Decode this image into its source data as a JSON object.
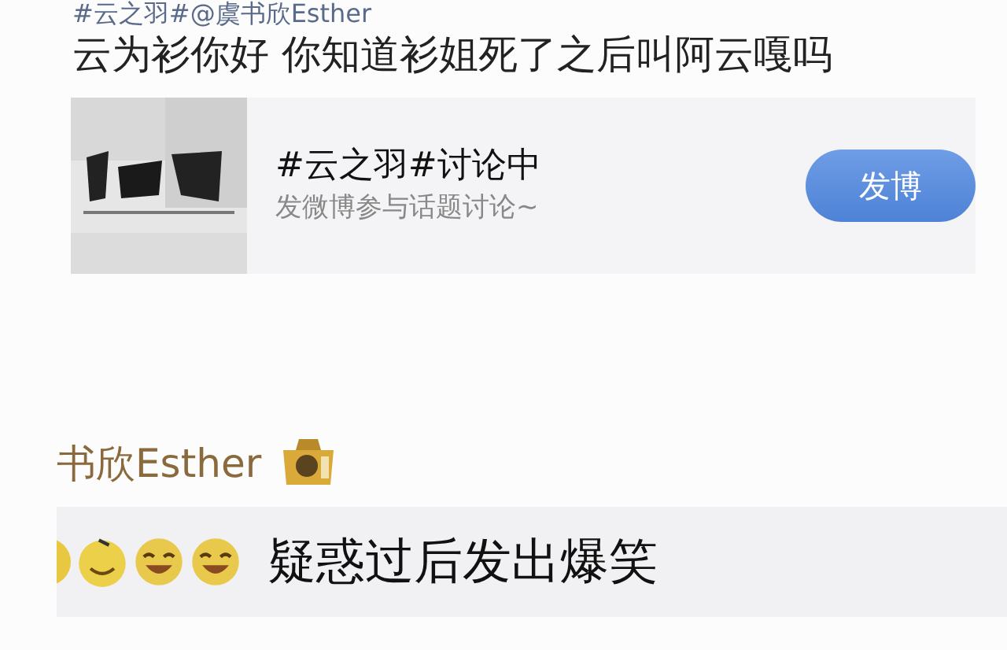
{
  "post": {
    "tags_line": "#云之羽#@虞书欣Esther",
    "text": "云为衫你好 你知道衫姐死了之后叫阿云嘎吗"
  },
  "topic_card": {
    "title": "#云之羽#讨论中",
    "subtitle": "发微博参与话题讨论~",
    "button": "发博"
  },
  "reply": {
    "author": "书欣Esther",
    "text": "疑惑过后发出爆笑"
  }
}
